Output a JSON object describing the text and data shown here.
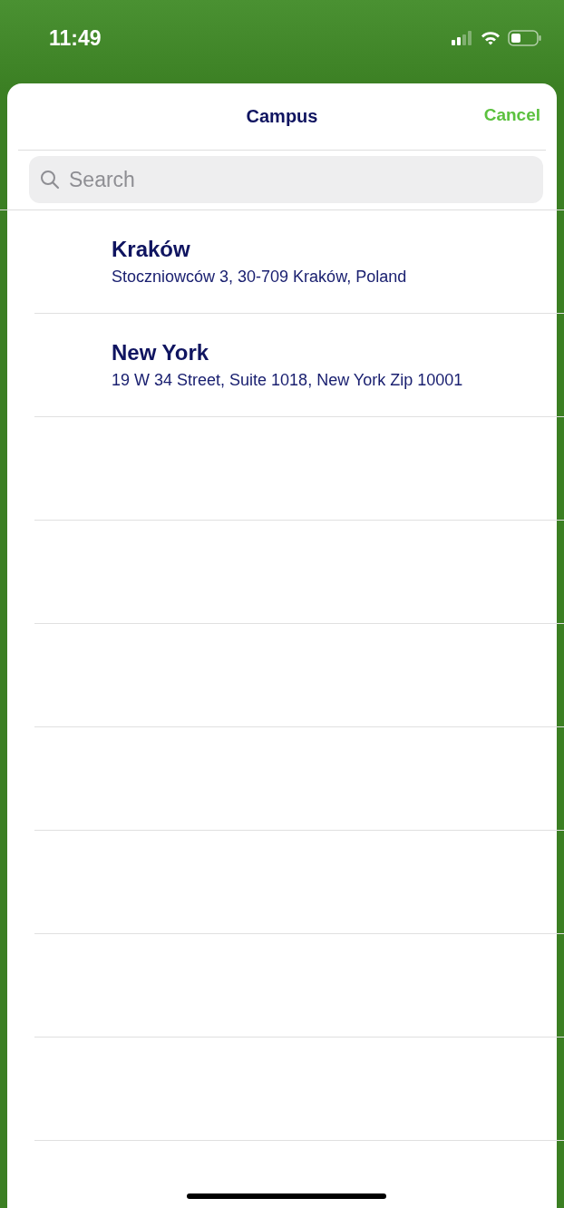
{
  "status_bar": {
    "time": "11:49"
  },
  "header": {
    "title": "Campus",
    "cancel": "Cancel"
  },
  "search": {
    "placeholder": "Search"
  },
  "campuses": [
    {
      "name": "Kraków",
      "address": "Stoczniowców 3, 30-709 Kraków, Poland"
    },
    {
      "name": "New York",
      "address": "19 W 34 Street, Suite 1018, New York Zip 10001"
    }
  ]
}
